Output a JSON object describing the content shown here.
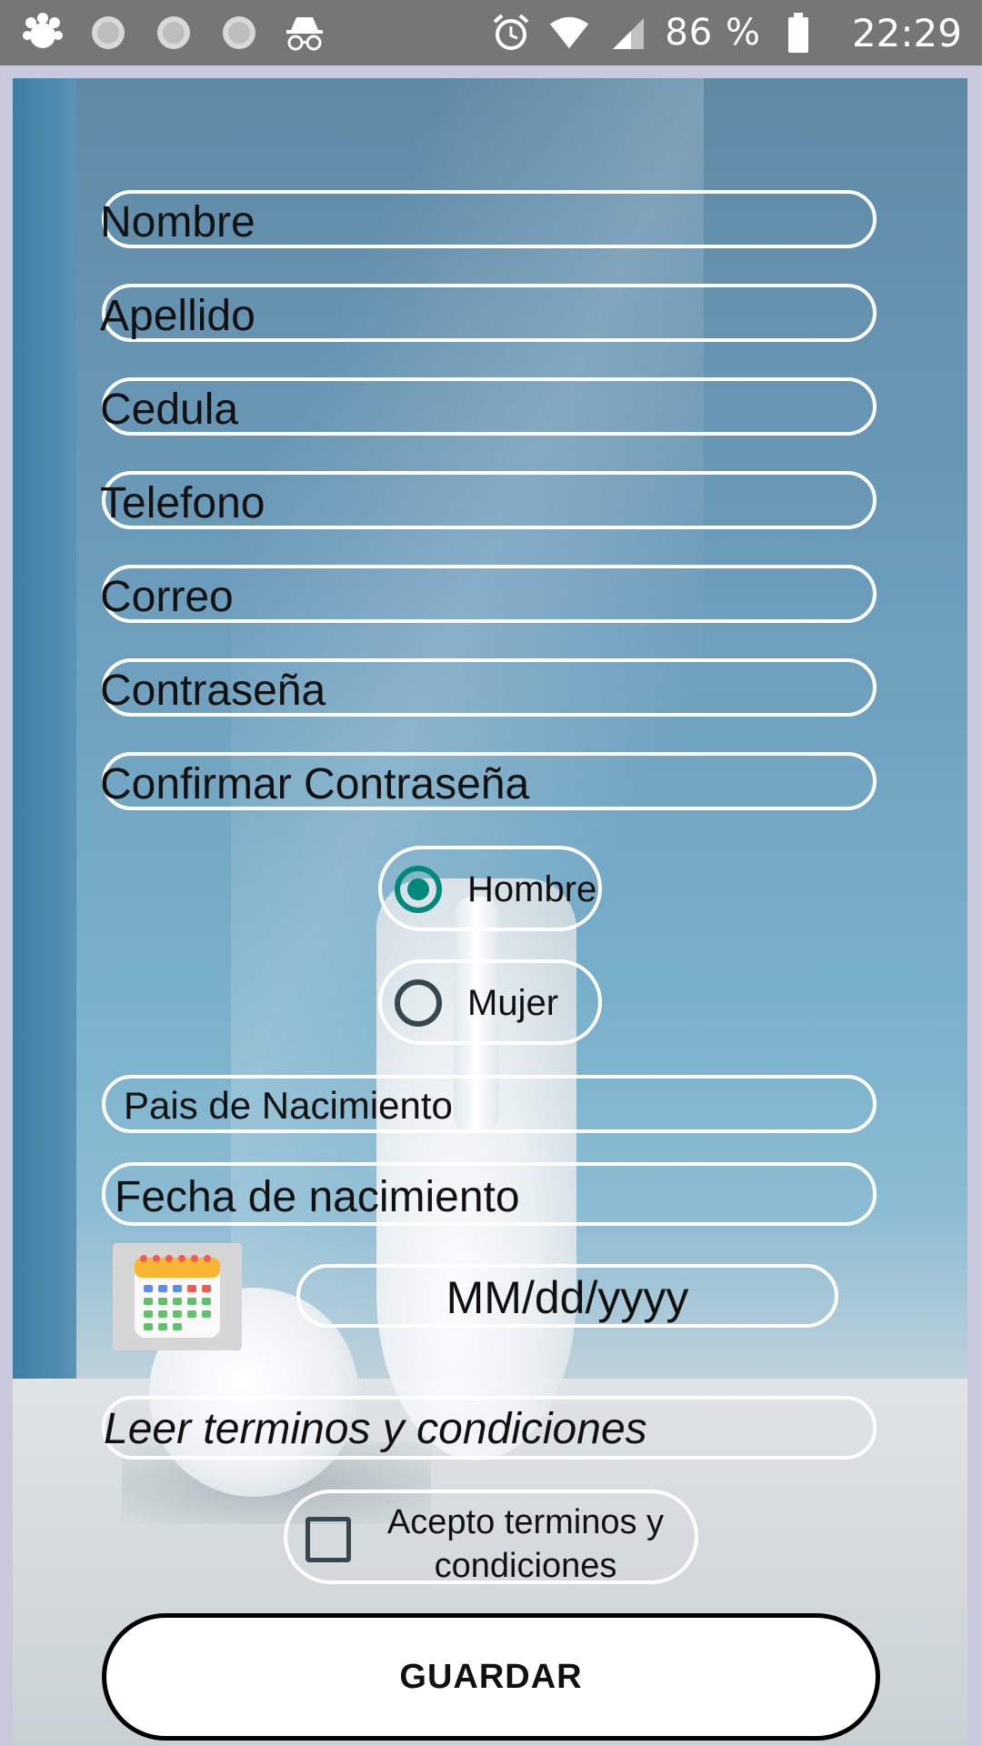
{
  "status_bar": {
    "left_icons": [
      "paw-icon",
      "loading-icon",
      "loading-icon",
      "loading-icon",
      "incognito-icon"
    ],
    "battery_text": "86 %",
    "time": "22:29"
  },
  "form": {
    "fields": [
      {
        "name": "nombre-input",
        "placeholder": "Nombre"
      },
      {
        "name": "apellido-input",
        "placeholder": "Apellido"
      },
      {
        "name": "cedula-input",
        "placeholder": "Cedula"
      },
      {
        "name": "telefono-input",
        "placeholder": "Telefono"
      },
      {
        "name": "correo-input",
        "placeholder": "Correo"
      },
      {
        "name": "contrasena-input",
        "placeholder": "Contraseña"
      },
      {
        "name": "confirmar-contrasena-input",
        "placeholder": "Confirmar Contraseña"
      }
    ],
    "gender": {
      "options": [
        {
          "label": "Hombre",
          "checked": true
        },
        {
          "label": "Mujer",
          "checked": false
        }
      ],
      "selected_color": "#00897b"
    },
    "pais_placeholder": "Pais de Nacimiento",
    "fecha_label": "Fecha de nacimiento",
    "date_placeholder": "MM/dd/yyyy",
    "terms_link": "Leer terminos y condiciones",
    "accept_line1": "Acepto terminos y",
    "accept_line2": "condiciones",
    "save_label": "GUARDAR"
  }
}
